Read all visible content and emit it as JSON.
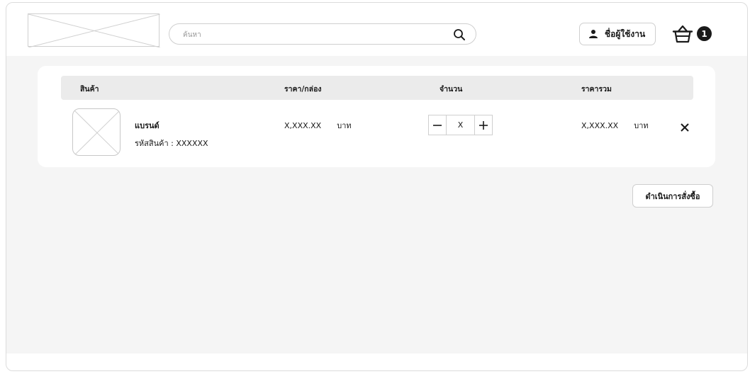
{
  "colors": {
    "accent": "#1a1a1a",
    "background": "#f5f5f5",
    "surface": "#ffffff",
    "header_row": "#ebebeb"
  },
  "header": {
    "logo_icon": "logo-placeholder",
    "search": {
      "placeholder": "ค้นหา",
      "value": "",
      "icon": "search-icon"
    },
    "user": {
      "icon": "user-icon",
      "label": "ชื่อผู้ใช้งาน"
    },
    "cart": {
      "icon": "basket-icon",
      "count": "1"
    }
  },
  "cart_table": {
    "columns": {
      "product": "สินค้า",
      "price_per_box": "ราคา/กล่อง",
      "quantity": "จำนวน",
      "total": "ราคารวม"
    },
    "items": [
      {
        "image": "product-image-placeholder",
        "brand": "แบรนด์",
        "code": "รหัสสินค้า : XXXXXX",
        "price": "X,XXX.XX",
        "price_unit": "บาท",
        "quantity": "X",
        "decrement_icon": "minus-icon",
        "increment_icon": "plus-icon",
        "total": "X,XXX.XX",
        "total_unit": "บาท",
        "remove_icon": "close-icon"
      }
    ]
  },
  "actions": {
    "checkout_label": "ดำเนินการสั่งซื้อ"
  }
}
